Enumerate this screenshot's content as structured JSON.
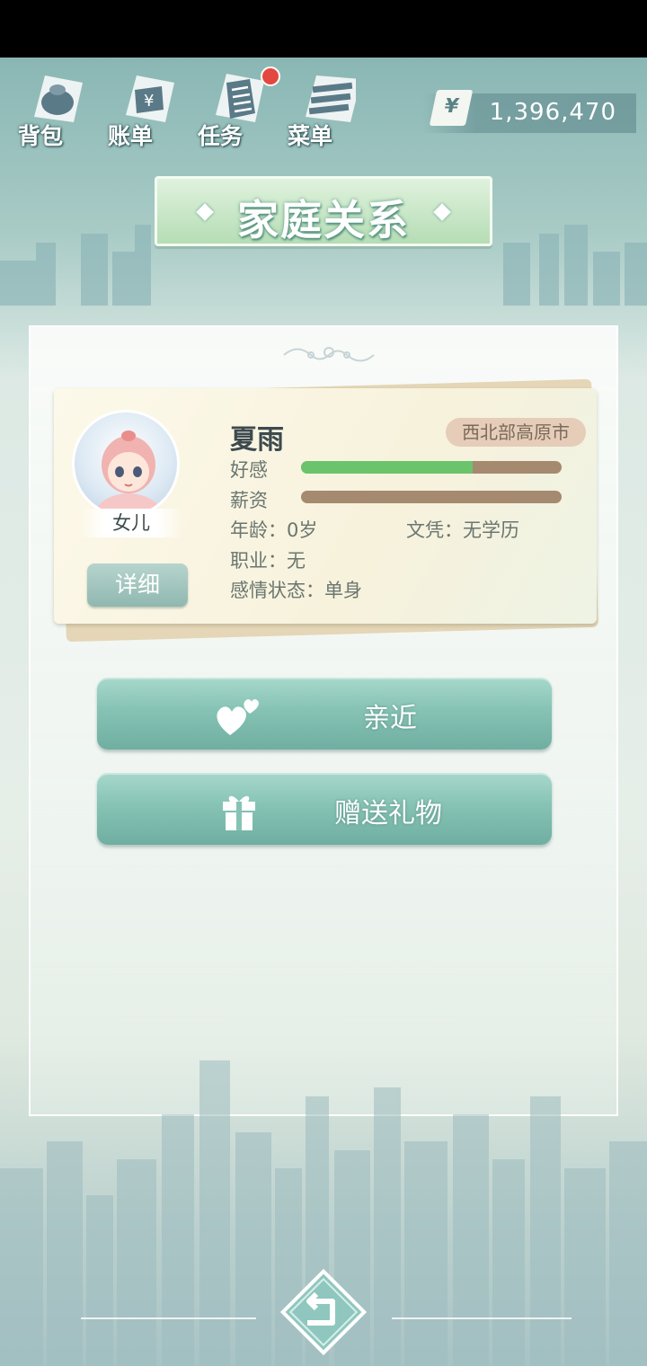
{
  "top_menu": {
    "items": [
      {
        "label": "背包",
        "icon": "bag-icon"
      },
      {
        "label": "账单",
        "icon": "bill-icon"
      },
      {
        "label": "任务",
        "icon": "task-icon",
        "has_notification": true
      },
      {
        "label": "菜单",
        "icon": "menu-icon"
      }
    ]
  },
  "money": {
    "symbol": "¥",
    "amount": "1,396,470"
  },
  "page_title": "家庭关系",
  "member": {
    "name": "夏雨",
    "relation": "女儿",
    "region": "西北部高原市",
    "detail_label": "详细",
    "favor_label": "好感",
    "favor_fraction": 0.66,
    "salary_label": "薪资",
    "salary_fraction": 0.0,
    "age_text": "年龄：0岁",
    "education_text": "文凭：无学历",
    "job_text": "职业：无",
    "relationship_text": "感情状态：单身"
  },
  "actions": {
    "approach_label": "亲近",
    "gift_label": "赠送礼物"
  },
  "colors": {
    "favor_bar": "#6bc46b",
    "bar_track": "#a58a6f",
    "button_teal": "#86c3b5",
    "title_banner": "#b6ddb5"
  }
}
